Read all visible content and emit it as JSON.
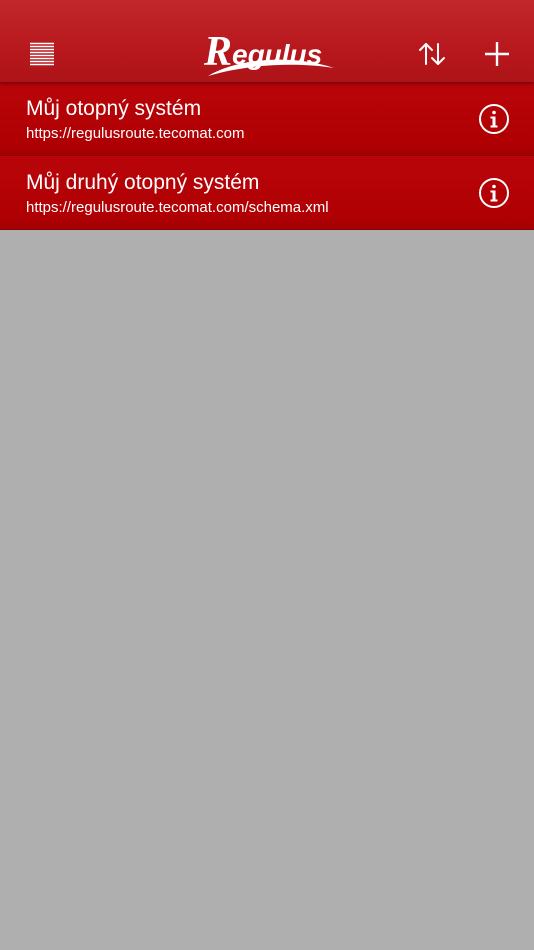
{
  "header": {
    "logo_text": "Regulus",
    "menu_icon": "list-menu-icon",
    "sort_icon": "sort-arrows-icon",
    "add_icon": "plus-icon"
  },
  "systems": [
    {
      "title": "Můj otopný systém",
      "url": "https://regulusroute.tecomat.com",
      "info_icon": "info-icon"
    },
    {
      "title": "Můj druhý otopný systém",
      "url": "https://regulusroute.tecomat.com/schema.xml",
      "info_icon": "info-icon"
    }
  ],
  "colors": {
    "header": "#b8181d",
    "list_item": "#b00004",
    "background": "#afafaf",
    "text": "#ffffff"
  }
}
